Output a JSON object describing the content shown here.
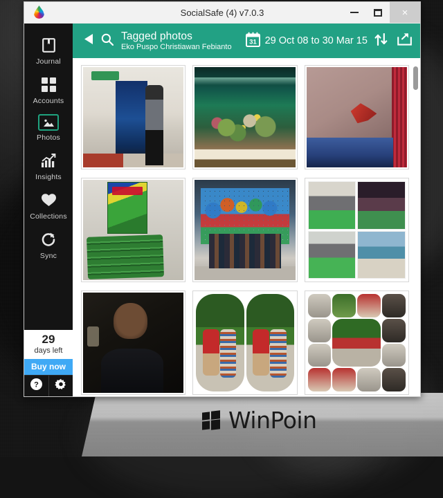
{
  "window": {
    "title": "SocialSafe (4) v7.0.3",
    "app_icon": "rainbow-droplet-icon",
    "controls": {
      "minimize": "minimize-icon",
      "maximize": "maximize-icon",
      "close": "×"
    }
  },
  "sidebar": {
    "items": [
      {
        "label": "Journal",
        "icon": "book-icon",
        "active": false
      },
      {
        "label": "Accounts",
        "icon": "grid-icon",
        "active": false
      },
      {
        "label": "Photos",
        "icon": "photo-icon",
        "active": true
      },
      {
        "label": "Insights",
        "icon": "chart-icon",
        "active": false
      },
      {
        "label": "Collections",
        "icon": "heart-icon",
        "active": false
      },
      {
        "label": "Sync",
        "icon": "refresh-icon",
        "active": false
      }
    ],
    "trial": {
      "days": "29",
      "days_text": "days left",
      "buy_label": "Buy now"
    },
    "bottom_buttons": [
      {
        "name": "help-button",
        "icon": "question-mark-icon"
      },
      {
        "name": "settings-button",
        "icon": "gear-icon"
      }
    ]
  },
  "topbar": {
    "back_icon": "back-arrow-icon",
    "search_icon": "search-icon",
    "title": "Tagged photos",
    "subtitle": "Eko Puspo Christiawan Febianto",
    "calendar_icon": "calendar-icon",
    "calendar_day": "31",
    "date_range": "29 Oct 08 to 30 Mar 15",
    "sort_icon": "sort-arrows-icon",
    "share_icon": "share-export-icon",
    "accent_color": "#22a184"
  },
  "grid": {
    "photos": [
      {
        "id": "photo-1",
        "alt": "Man standing beside Microsoft event banner near EXIT sign"
      },
      {
        "id": "photo-2",
        "alt": "Coral reef aquarium with yellow fish"
      },
      {
        "id": "photo-3",
        "alt": "Red betta fish in tank with blue gravel"
      },
      {
        "id": "photo-4",
        "alt": "Stack of Kwartet Biologi card game boxes"
      },
      {
        "id": "photo-5",
        "alt": "Group of people in front of colourful dicomtech cube wall"
      },
      {
        "id": "photo-6",
        "alt": "Four photo collage of two friends in green shirts"
      },
      {
        "id": "photo-7",
        "alt": "Dark mirror selfie of man holding phone"
      },
      {
        "id": "photo-8",
        "alt": "Two-panel photo of couple sitting outdoors in red shirts"
      },
      {
        "id": "photo-9",
        "alt": "Multi-tile collage of outdoor couple photos"
      }
    ]
  },
  "scrollbar": {
    "name": "vertical-scrollbar",
    "thumb_position": "top"
  },
  "watermark": {
    "text": "WinPoin",
    "logo": "windows-tiles-icon"
  }
}
